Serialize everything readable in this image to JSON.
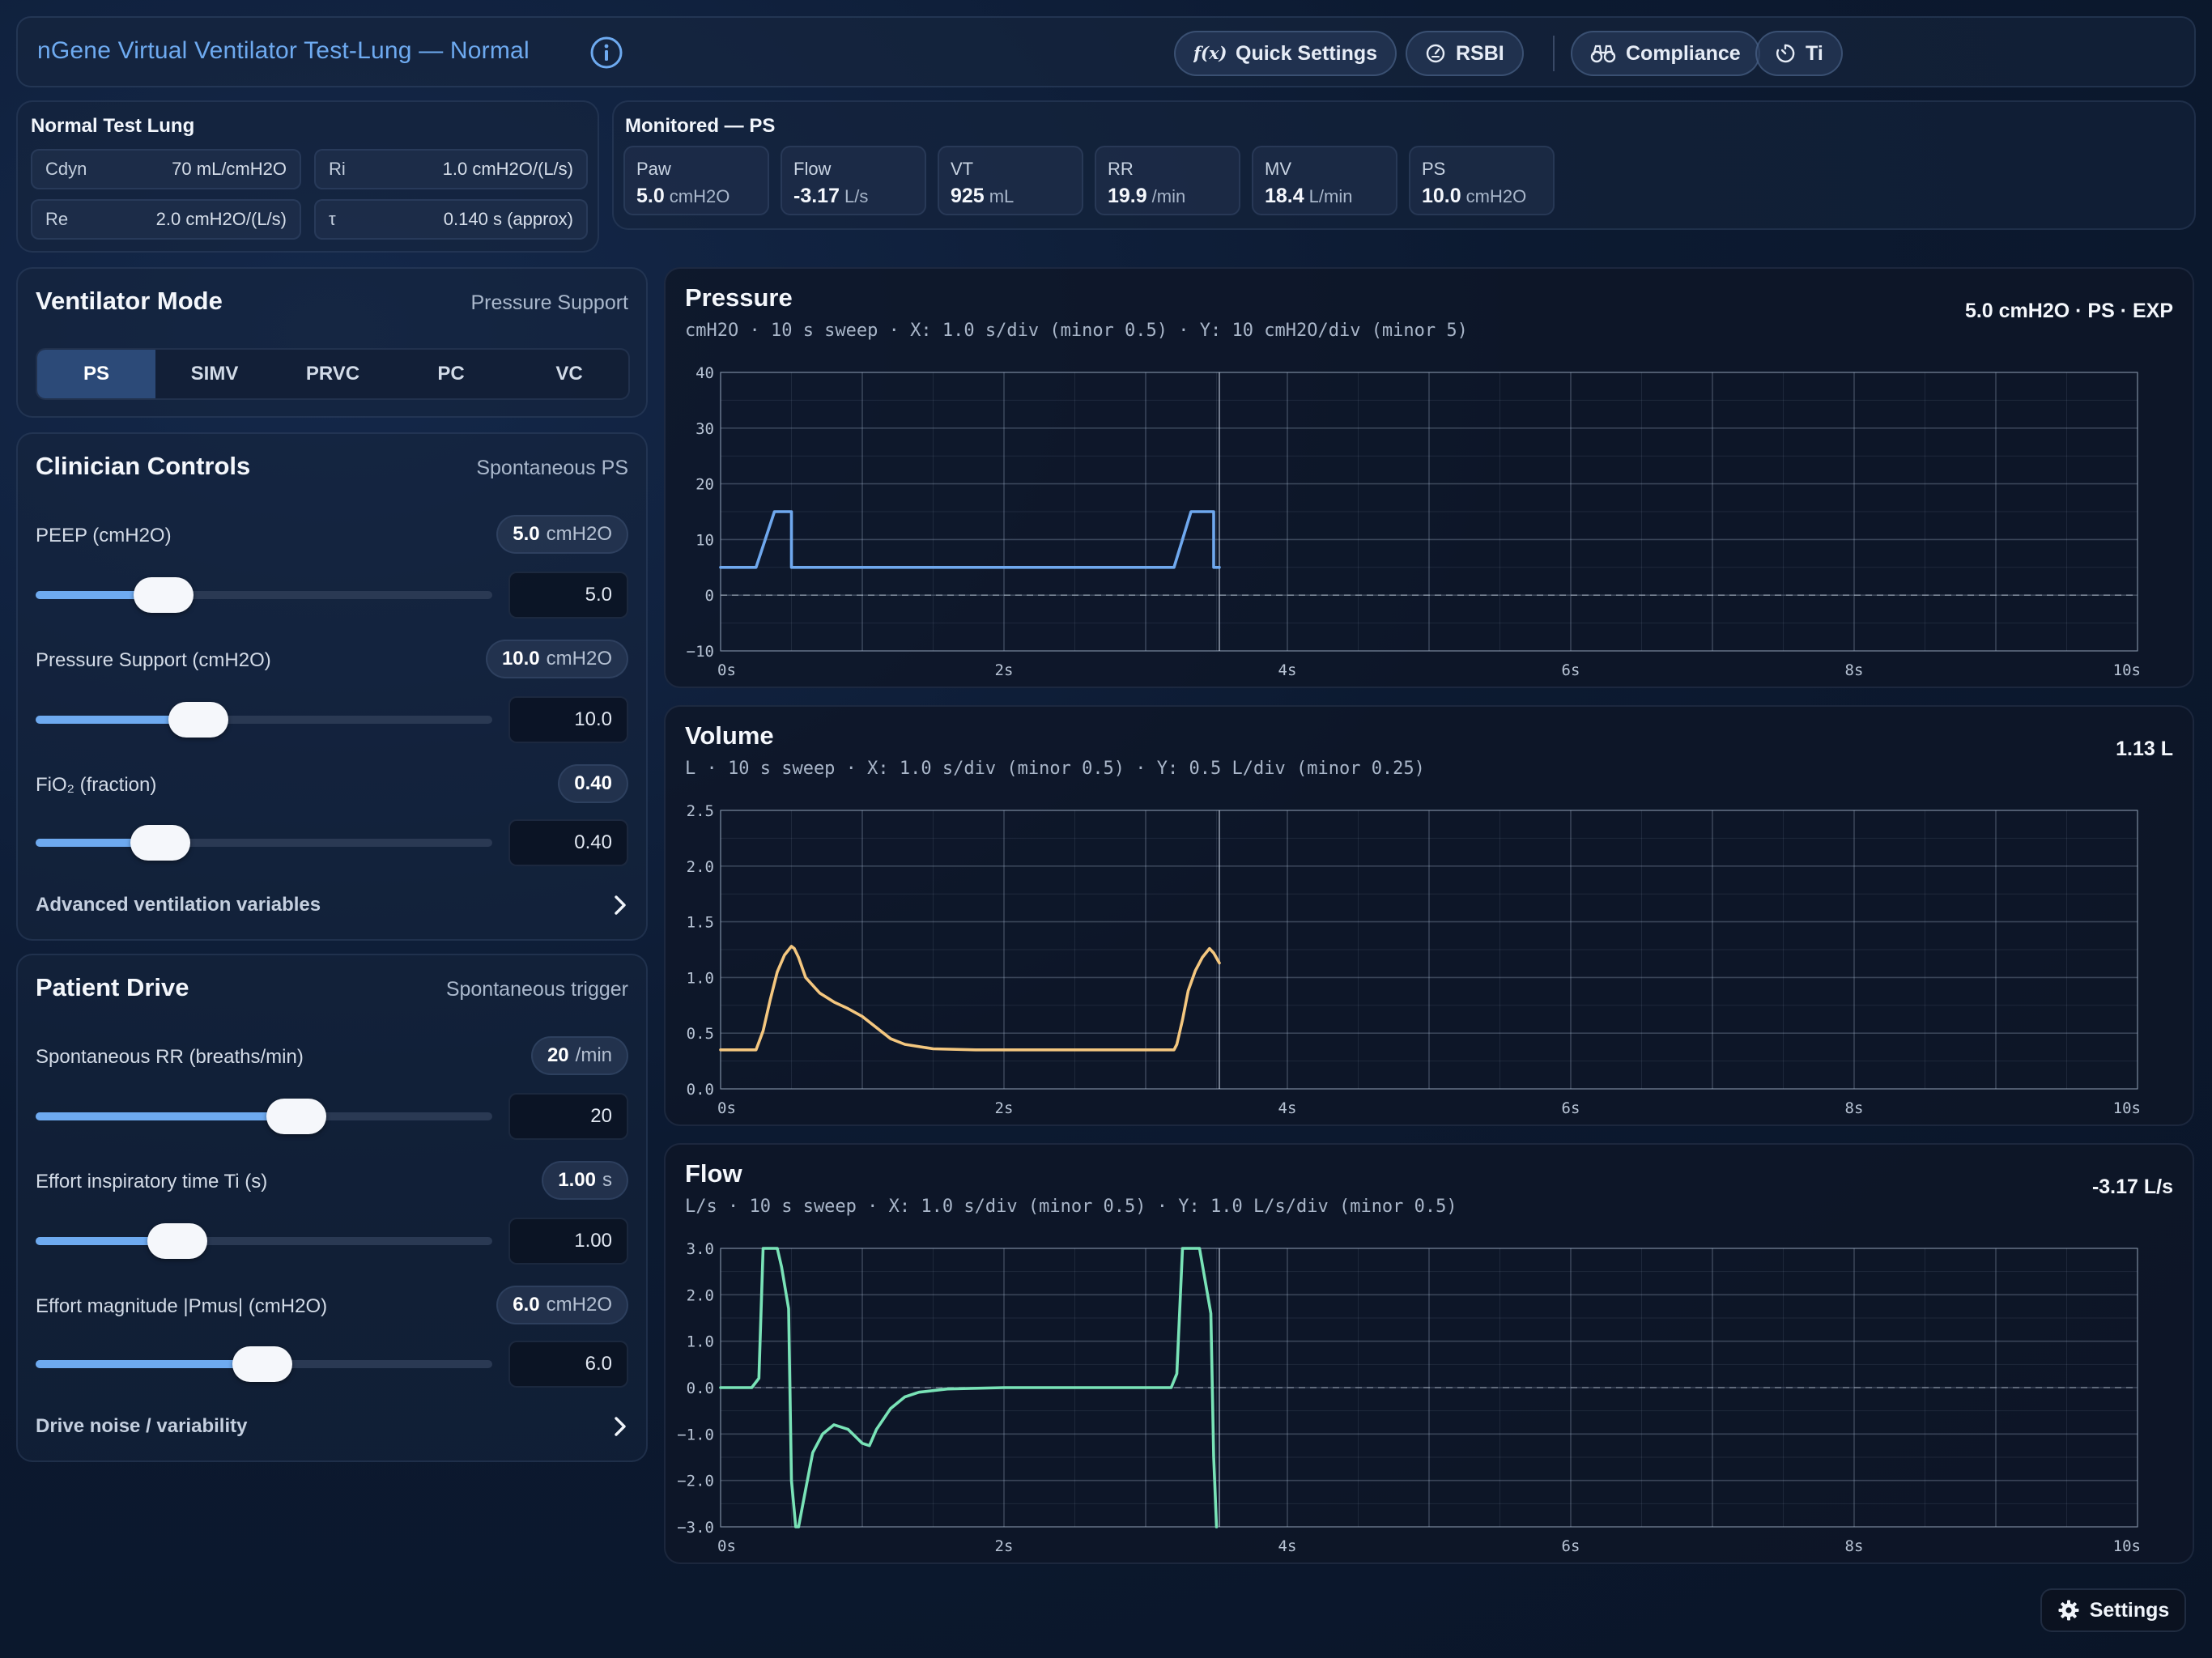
{
  "header": {
    "title": "nGene Virtual Ventilator Test-Lung — Normal",
    "buttons": {
      "quick_settings": "Quick Settings",
      "rsbi": "RSBI",
      "compliance": "Compliance",
      "ti": "Ti"
    }
  },
  "lung": {
    "title": "Normal Test Lung",
    "params": [
      {
        "key": "Cdyn",
        "value": "70 mL/cmH2O"
      },
      {
        "key": "Ri",
        "value": "1.0 cmH2O/(L/s)"
      },
      {
        "key": "Re",
        "value": "2.0 cmH2O/(L/s)"
      },
      {
        "key": "τ",
        "value": "0.140 s (approx)"
      }
    ]
  },
  "monitored": {
    "title": "Monitored — PS",
    "items": [
      {
        "label": "Paw",
        "value": "5.0",
        "unit": "cmH2O"
      },
      {
        "label": "Flow",
        "value": "-3.17",
        "unit": "L/s"
      },
      {
        "label": "VT",
        "value": "925",
        "unit": "mL"
      },
      {
        "label": "RR",
        "value": "19.9",
        "unit": "/min"
      },
      {
        "label": "MV",
        "value": "18.4",
        "unit": "L/min"
      },
      {
        "label": "PS",
        "value": "10.0",
        "unit": "cmH2O"
      }
    ]
  },
  "mode": {
    "title": "Ventilator Mode",
    "subtitle": "Pressure Support",
    "options": [
      "PS",
      "SIMV",
      "PRVC",
      "PC",
      "VC"
    ],
    "selected": "PS"
  },
  "clinician": {
    "title": "Clinician Controls",
    "subtitle": "Spontaneous PS",
    "controls": [
      {
        "label": "PEEP (cmH2O)",
        "value": "5.0",
        "unit": "cmH2O",
        "input": "5.0",
        "fraction": 0.28
      },
      {
        "label": "Pressure Support (cmH2O)",
        "value": "10.0",
        "unit": "cmH2O",
        "input": "10.0",
        "fraction": 0.357
      },
      {
        "label": "FiO₂ (fraction)",
        "value": "0.40",
        "unit": "",
        "input": "0.40",
        "fraction": 0.273
      }
    ],
    "advanced": "Advanced ventilation variables"
  },
  "drive": {
    "title": "Patient Drive",
    "subtitle": "Spontaneous trigger",
    "controls": [
      {
        "label": "Spontaneous RR (breaths/min)",
        "value": "20",
        "unit": "/min",
        "input": "20",
        "fraction": 0.571
      },
      {
        "label": "Effort inspiratory time Ti (s)",
        "value": "1.00",
        "unit": "s",
        "input": "1.00",
        "fraction": 0.31
      },
      {
        "label": "Effort magnitude |Pmus| (cmH2O)",
        "value": "6.0",
        "unit": "cmH2O",
        "input": "6.0",
        "fraction": 0.497
      }
    ],
    "advanced": "Drive noise / variability"
  },
  "settings_button": "Settings",
  "colors": {
    "accent": "#6eaaf0",
    "pressure": "#6fa8ee",
    "volume": "#f4c77f",
    "flow": "#79e3b7"
  },
  "chart_data": [
    {
      "type": "line",
      "title": "Pressure",
      "subtitle": "cmH2O · 10 s sweep · X: 1.0 s/div (minor 0.5) · Y: 10 cmH2O/div (minor 5)",
      "readout": "5.0 cmH2O · PS · EXP",
      "xlim": [
        0,
        10
      ],
      "ylim": [
        -10,
        40
      ],
      "x_ticks": [
        "0s",
        "2s",
        "4s",
        "6s",
        "8s",
        "10s"
      ],
      "y_ticks": [
        "40",
        "30",
        "20",
        "10",
        "0",
        "−10"
      ],
      "sweep_position": 3.52,
      "x": [
        0,
        0.25,
        0.38,
        0.43,
        0.5,
        0.5,
        0.5,
        3.2,
        3.32,
        3.36,
        3.48,
        3.48,
        3.52
      ],
      "y": [
        5,
        5,
        15,
        15,
        15,
        5,
        5,
        5,
        15,
        15,
        15,
        5,
        5
      ]
    },
    {
      "type": "line",
      "title": "Volume",
      "subtitle": "L · 10 s sweep · X: 1.0 s/div (minor 0.5) · Y: 0.5 L/div (minor 0.25)",
      "readout": "1.13 L",
      "xlim": [
        0,
        10
      ],
      "ylim": [
        0,
        2.5
      ],
      "x_ticks": [
        "0s",
        "2s",
        "4s",
        "6s",
        "8s",
        "10s"
      ],
      "y_ticks": [
        "2.5",
        "2.0",
        "1.5",
        "1.0",
        "0.5",
        "0.0"
      ],
      "sweep_position": 3.52,
      "x": [
        0,
        0.25,
        0.3,
        0.35,
        0.4,
        0.45,
        0.5,
        0.52,
        0.55,
        0.6,
        0.7,
        0.8,
        0.9,
        1.0,
        1.1,
        1.2,
        1.3,
        1.5,
        1.8,
        2.2,
        3.2,
        3.22,
        3.26,
        3.3,
        3.35,
        3.4,
        3.45,
        3.48,
        3.52
      ],
      "y": [
        0.35,
        0.35,
        0.52,
        0.8,
        1.05,
        1.2,
        1.28,
        1.26,
        1.18,
        1.0,
        0.86,
        0.78,
        0.72,
        0.65,
        0.55,
        0.45,
        0.4,
        0.36,
        0.35,
        0.35,
        0.35,
        0.4,
        0.62,
        0.88,
        1.06,
        1.18,
        1.26,
        1.22,
        1.13
      ]
    },
    {
      "type": "line",
      "title": "Flow",
      "subtitle": "L/s · 10 s sweep · X: 1.0 s/div (minor 0.5) · Y: 1.0 L/s/div (minor 0.5)",
      "readout": "-3.17 L/s",
      "xlim": [
        0,
        10
      ],
      "ylim": [
        -3,
        3
      ],
      "x_ticks": [
        "0s",
        "2s",
        "4s",
        "6s",
        "8s",
        "10s"
      ],
      "y_ticks": [
        "3.0",
        "2.0",
        "1.0",
        "0.0",
        "−1.0",
        "−2.0",
        "−3.0"
      ],
      "sweep_position": 3.52,
      "x": [
        0,
        0.22,
        0.27,
        0.3,
        0.4,
        0.43,
        0.48,
        0.5,
        0.53,
        0.55,
        0.6,
        0.65,
        0.72,
        0.8,
        0.9,
        1.0,
        1.05,
        1.1,
        1.2,
        1.3,
        1.4,
        1.6,
        2.0,
        3.18,
        3.22,
        3.26,
        3.3,
        3.38,
        3.46,
        3.48,
        3.5
      ],
      "y": [
        0,
        0,
        0.2,
        3.0,
        3.0,
        2.6,
        1.7,
        -2.0,
        -3.0,
        -3.0,
        -2.2,
        -1.4,
        -1.0,
        -0.8,
        -0.9,
        -1.2,
        -1.25,
        -0.9,
        -0.45,
        -0.2,
        -0.1,
        -0.03,
        0,
        0,
        0.3,
        3.0,
        3.0,
        3.0,
        1.6,
        -1.5,
        -3.0
      ]
    }
  ]
}
